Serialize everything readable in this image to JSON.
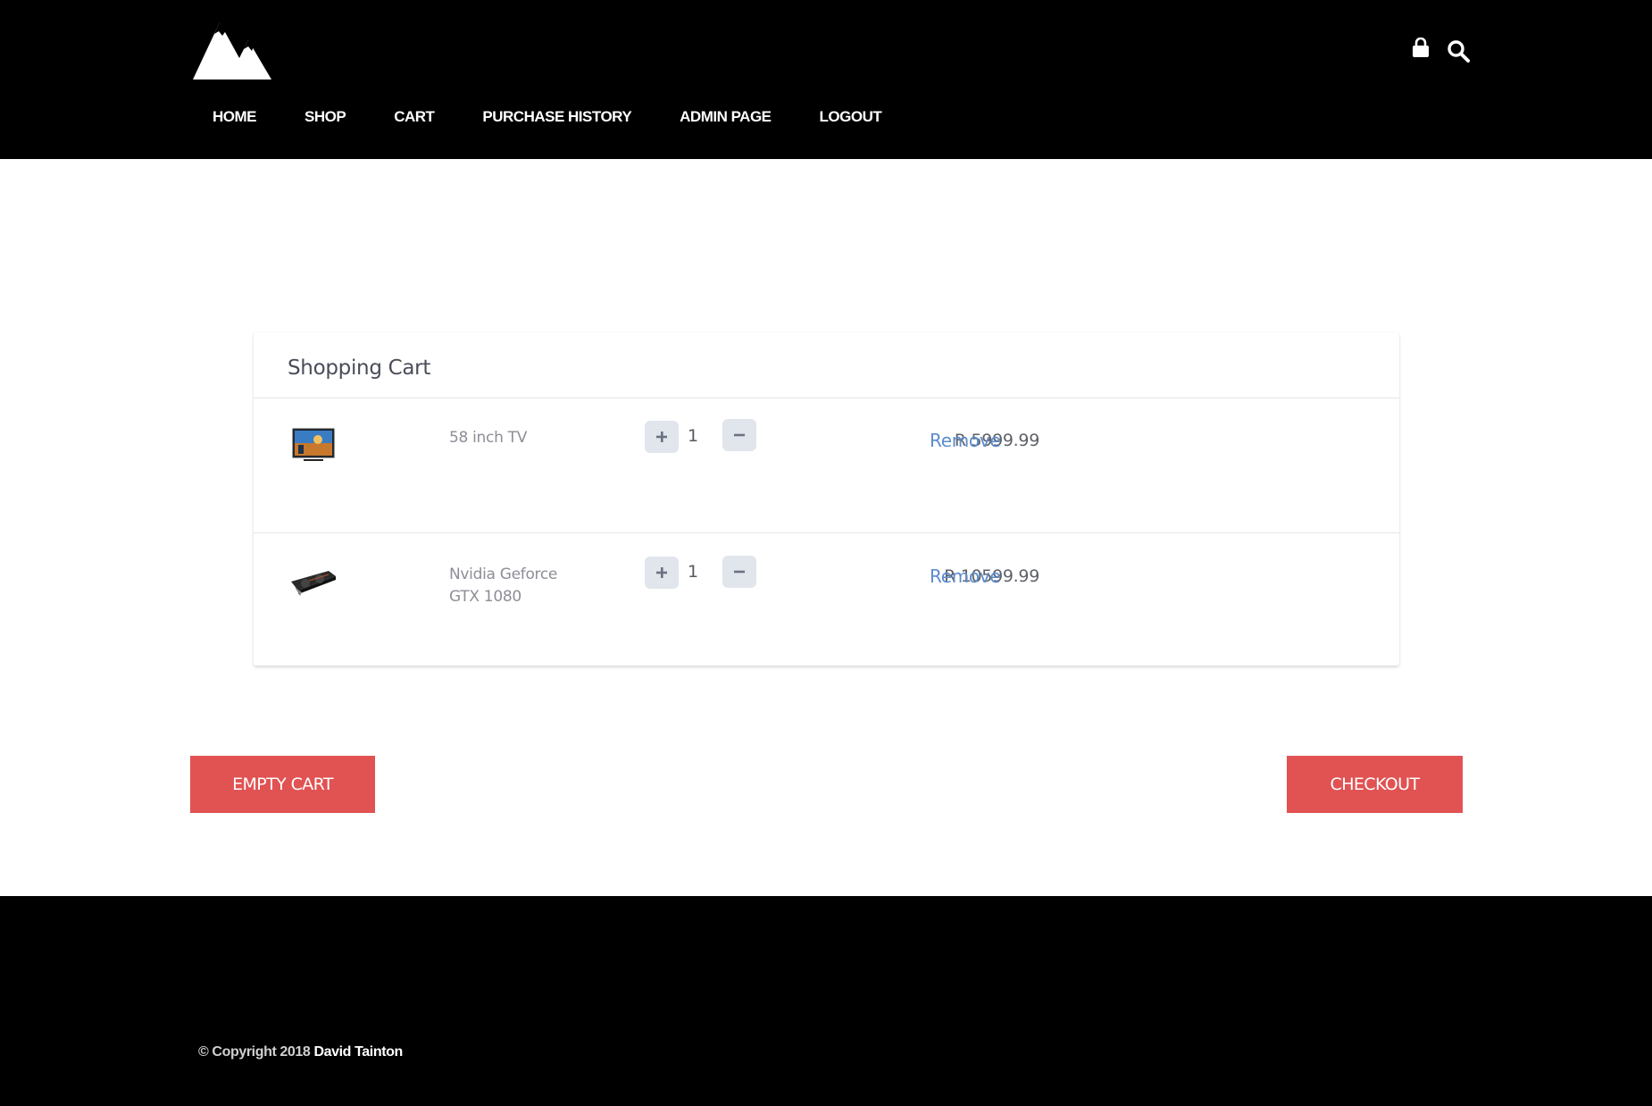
{
  "header": {
    "logo_icon": "mountain-logo",
    "icons": [
      "shopping-bag-icon",
      "search-icon"
    ],
    "nav": [
      {
        "label": "HOME"
      },
      {
        "label": "SHOP"
      },
      {
        "label": "CART"
      },
      {
        "label": "PURCHASE HISTORY"
      },
      {
        "label": "ADMIN PAGE"
      },
      {
        "label": "LOGOUT"
      }
    ]
  },
  "cart": {
    "title": "Shopping Cart",
    "items": [
      {
        "name": "58 inch TV",
        "quantity": "1",
        "price": "R 5999.99",
        "remove_label": "Remove",
        "image": "tv-image"
      },
      {
        "name": "Nvidia Geforce GTX 1080",
        "quantity": "1",
        "price": "R 10599.99",
        "remove_label": "Remove",
        "image": "graphics-card-image"
      }
    ]
  },
  "actions": {
    "empty_label": "EMPTY CART",
    "checkout_label": "CHECKOUT",
    "button_color": "#e15252"
  },
  "footer": {
    "copyright_prefix": "© Copyright 2018",
    "author": "David Tainton"
  }
}
